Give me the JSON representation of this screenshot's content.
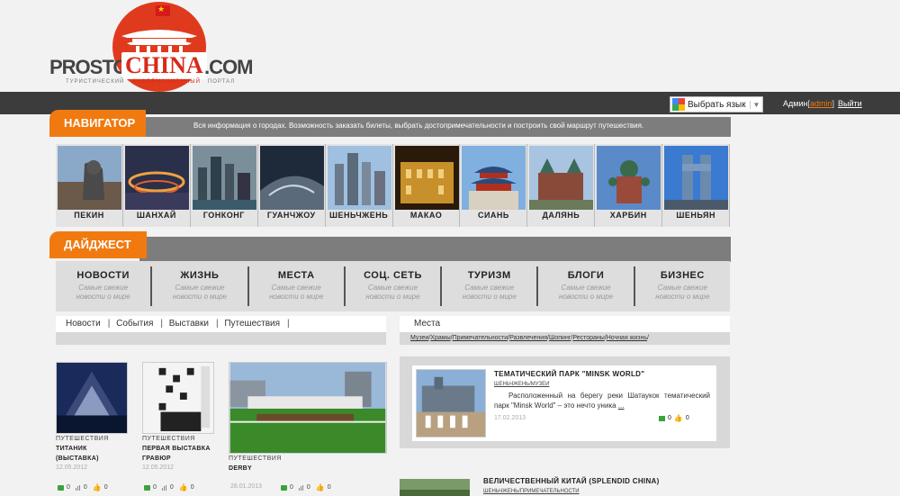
{
  "logo": {
    "prosto": "PROSTO",
    "china": "CHINA",
    "com": ".COM",
    "sub1": "ТУРИСТИЧЕСКИЙ",
    "sub2": "ИНФОРМАЦИОННЫЙ",
    "sub3": "ПОРТАЛ"
  },
  "topbar": {
    "language_select": "Выбрать язык",
    "admin_label": "Админ",
    "admin_bracket_open": "[",
    "admin_name": "admin",
    "admin_bracket_close": "]",
    "logout": "Выйти"
  },
  "navigator": {
    "title": "НАВИГАТОР",
    "description": "Вся информация о городах. Возможность заказать билеты, выбрать достопримечательности и построить свой маршрут путешествия.",
    "cities": [
      "ПЕКИН",
      "ШАНХАЙ",
      "ГОНКОНГ",
      "ГУАНЧЖОУ",
      "ШЕНЬЧЖЕНЬ",
      "МАКАО",
      "СИАНЬ",
      "ДАЛЯНЬ",
      "ХАРБИН",
      "ШЕНЬЯН"
    ]
  },
  "digest": {
    "title": "ДАЙДЖЕСТ",
    "columns": [
      {
        "title": "НОВОСТИ",
        "sub1": "Самые свежие",
        "sub2": "новости о мире"
      },
      {
        "title": "ЖИЗНЬ",
        "sub1": "Самые свежие",
        "sub2": "новости о мире"
      },
      {
        "title": "МЕСТА",
        "sub1": "Самые свежие",
        "sub2": "новости о мире"
      },
      {
        "title": "СОЦ. СЕТЬ",
        "sub1": "Самые свежие",
        "sub2": "новости о мире"
      },
      {
        "title": "ТУРИЗМ",
        "sub1": "Самые свежие",
        "sub2": "новости о мире"
      },
      {
        "title": "БЛОГИ",
        "sub1": "Самые свежие",
        "sub2": "новости о мире"
      },
      {
        "title": "БИЗНЕС",
        "sub1": "Самые свежие",
        "sub2": "новости о мире"
      }
    ]
  },
  "left_tabs": [
    "Новости",
    "События",
    "Выставки",
    "Путешествия"
  ],
  "right_tabs": {
    "title": "Места",
    "sub": [
      "Музеи",
      "Храмы",
      "Примечательности",
      "Развлечения",
      "Шопинг",
      "Рестораны",
      "Ночная жизнь"
    ]
  },
  "left_articles": [
    {
      "category": "ПУТЕШЕСТВИЯ",
      "title1": "ТИТАНИК",
      "title2": "(ВЫСТАВКА)",
      "date": "12.05.2012",
      "comments": "0",
      "views": "0",
      "likes": "0"
    },
    {
      "category": "ПУТЕШЕСТВИЯ",
      "title1": "ПЕРВАЯ ВЫСТАВКА",
      "title2": "ГРАВЮР",
      "date": "12.05.2012",
      "comments": "0",
      "views": "0",
      "likes": "0"
    },
    {
      "category": "ПУТЕШЕСТВИЯ",
      "title1": "DERBY",
      "title2": "",
      "date": "28.01.2013",
      "comments": "0",
      "views": "0",
      "likes": "0"
    }
  ],
  "right_articles": [
    {
      "title": "ТЕМАТИЧЕСКИЙ ПАРК \"MINSK WORLD\"",
      "category": "ШЕНЬЧЖЕНЬ/МУЗЕИ",
      "text": "Расположенный на берегу реки Шатаукок тематический парк \"Minsk World\" – это нечто уника",
      "more": "...",
      "date": "17.02.2013",
      "comments": "0",
      "likes": "0"
    },
    {
      "title": "ВЕЛИЧЕСТВЕННЫЙ КИТАЙ (SPLENDID CHINA)",
      "category": "ШЕНЬЧЖЕНЬ/ПРИМЕЧАТЕЛЬНОСТИ"
    }
  ],
  "colors": {
    "accent": "#f07a10",
    "topbar": "#3c3c3c",
    "brand_red": "#d62a1a"
  }
}
